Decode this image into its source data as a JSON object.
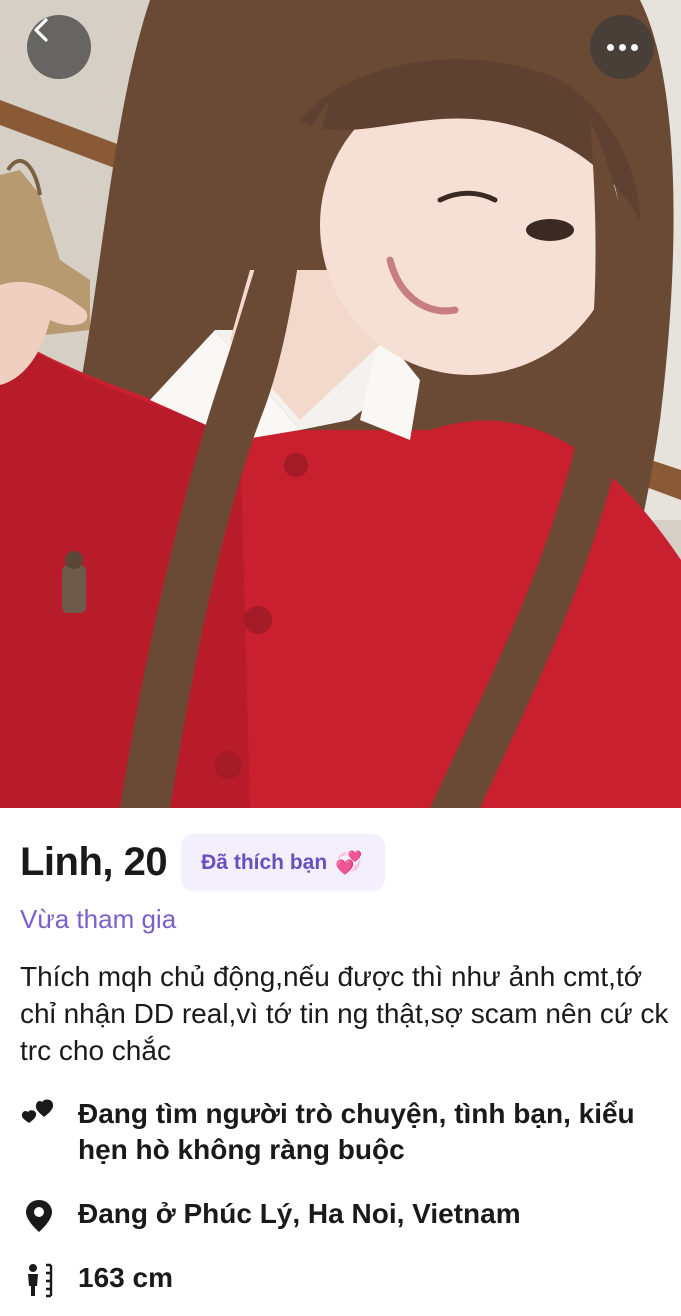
{
  "profile": {
    "name": "Linh, 20",
    "liked_badge": "Đã thích bạn",
    "liked_emoji": "💞",
    "status": "Vừa tham gia",
    "bio": "Thích mqh chủ động,nếu được thì như ảnh cmt,tớ chỉ nhận DD real,vì tớ tin ng thật,sợ scam nên cứ ck trc cho chắc",
    "looking_for": "Đang tìm người trò chuyện, tình bạn, kiểu hẹn hò không ràng buộc",
    "location": "Đang ở Phúc Lý, Ha Noi, Vietnam",
    "height": "163 cm"
  },
  "icons": {
    "back": "chevron-left-icon",
    "more": "more-horizontal-icon",
    "looking_for": "hearts-icon",
    "location": "location-pin-icon",
    "height": "height-icon"
  },
  "colors": {
    "accent_purple": "#6b4fbf",
    "badge_bg": "#f3effc",
    "status_purple": "#7b5fcc",
    "sweater_red": "#c8202f"
  }
}
